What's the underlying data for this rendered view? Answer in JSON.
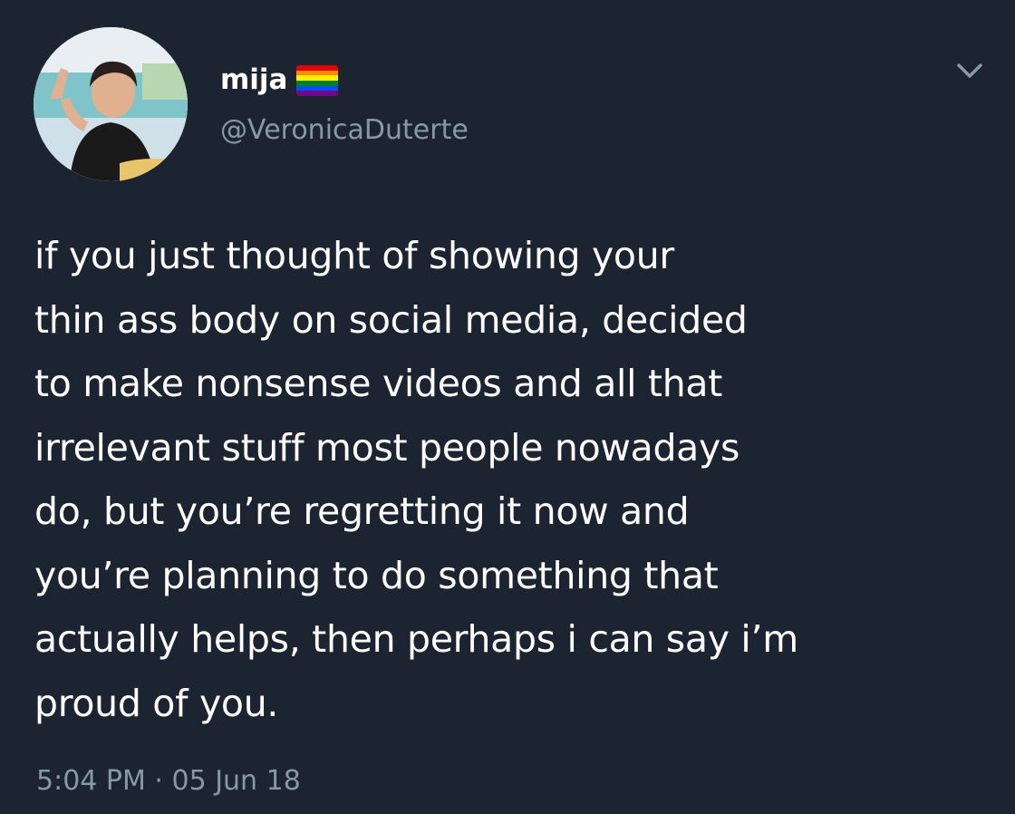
{
  "user": {
    "display_name": "mija",
    "handle": "@VeronicaDuterte",
    "avatar_icon": "profile-photo",
    "flag_icon": "rainbow-flag-emoji"
  },
  "tweet": {
    "lines": [
      "if you just thought of showing your",
      "thin ass body on social media, decided",
      "to make nonsense videos and all that",
      "irrelevant stuff most people nowadays",
      "do, but you’re regretting it now and",
      "you’re planning to do something that",
      "actually helps, then perhaps i can say i’m",
      "proud of you."
    ],
    "timestamp": "5:04 PM · 05 Jun 18"
  },
  "menu": {
    "icon": "chevron-down-icon"
  },
  "colors": {
    "background": "#1c2331",
    "text_primary": "#ffffff",
    "text_secondary": "#8899a6",
    "flag_stripes": [
      "#e40303",
      "#ff8c00",
      "#ffed00",
      "#008026",
      "#004dff",
      "#750787"
    ]
  }
}
